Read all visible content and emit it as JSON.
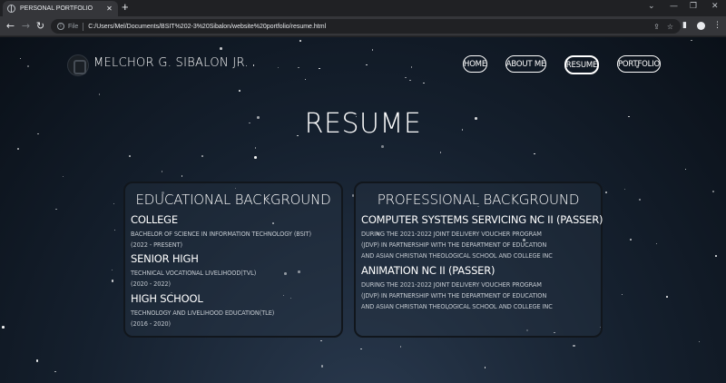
{
  "browser": {
    "tab_title": "PERSONAL PORTFOLIO",
    "tab_close": "✕",
    "new_tab": "+",
    "file_label": "File",
    "url": "C:/Users/Mel/Documents/BSIT%202-3%20Sibalon/website%20portfolio/resume.html",
    "icons": [
      "back-icon",
      "forward-icon",
      "reload-icon",
      "info-icon",
      "share-icon",
      "star-icon",
      "sidebar-icon",
      "profile-icon",
      "menu-icon"
    ]
  },
  "site": {
    "name": "MELCHOR G. SIBALON JR.",
    "nav": [
      "HOME",
      "ABOUT ME",
      "RESUME",
      "PORTFOLIO"
    ],
    "active_nav": "RESUME"
  },
  "page_title": "RESUME",
  "education": {
    "heading": "EDUCATIONAL BACKGROUND",
    "items": [
      {
        "title": "COLLEGE",
        "lines": [
          "BACHELOR OF SCIENCE IN INFORMATION TECHNOLOGY (BSIT)",
          "(2022 - PRESENT)"
        ]
      },
      {
        "title": "SENIOR HIGH",
        "lines": [
          "TECHNICAL VOCATIONAL LIVELIHOOD(TVL)",
          "(2020 - 2022)"
        ]
      },
      {
        "title": "HIGH SCHOOL",
        "lines": [
          "TECHNOLOGY AND LIVELIHOOD EDUCATION(TLE)",
          "(2016 - 2020)"
        ]
      }
    ]
  },
  "professional": {
    "heading": "PROFESSIONAL BACKGROUND",
    "items": [
      {
        "title": "COMPUTER SYSTEMS SERVICING NC II (PASSER)",
        "lines": [
          "DURING THE 2021-2022 JOINT DELIVERY VOUCHER PROGRAM",
          "(JDVP) IN PARTNERSHIP WITH THE DEPARTMENT OF EDUCATION",
          "AND ASIAN CHRISTIAN THEOLOGICAL SCHOOL AND COLLEGE INC"
        ]
      },
      {
        "title": "ANIMATION NC II (PASSER)",
        "lines": [
          "DURING THE 2021-2022 JOINT DELIVERY VOUCHER PROGRAM",
          "(JDVP) IN PARTNERSHIP WITH THE DEPARTMENT OF EDUCATION",
          "AND ASIAN CHRISTIAN THEOLOGICAL SCHOOL AND COLLEGE INC"
        ]
      }
    ]
  },
  "colors": {
    "background_top": "#0a1018",
    "background_bottom": "#2a3a4f",
    "text": "#ffffff",
    "card_border": "#11161c"
  }
}
